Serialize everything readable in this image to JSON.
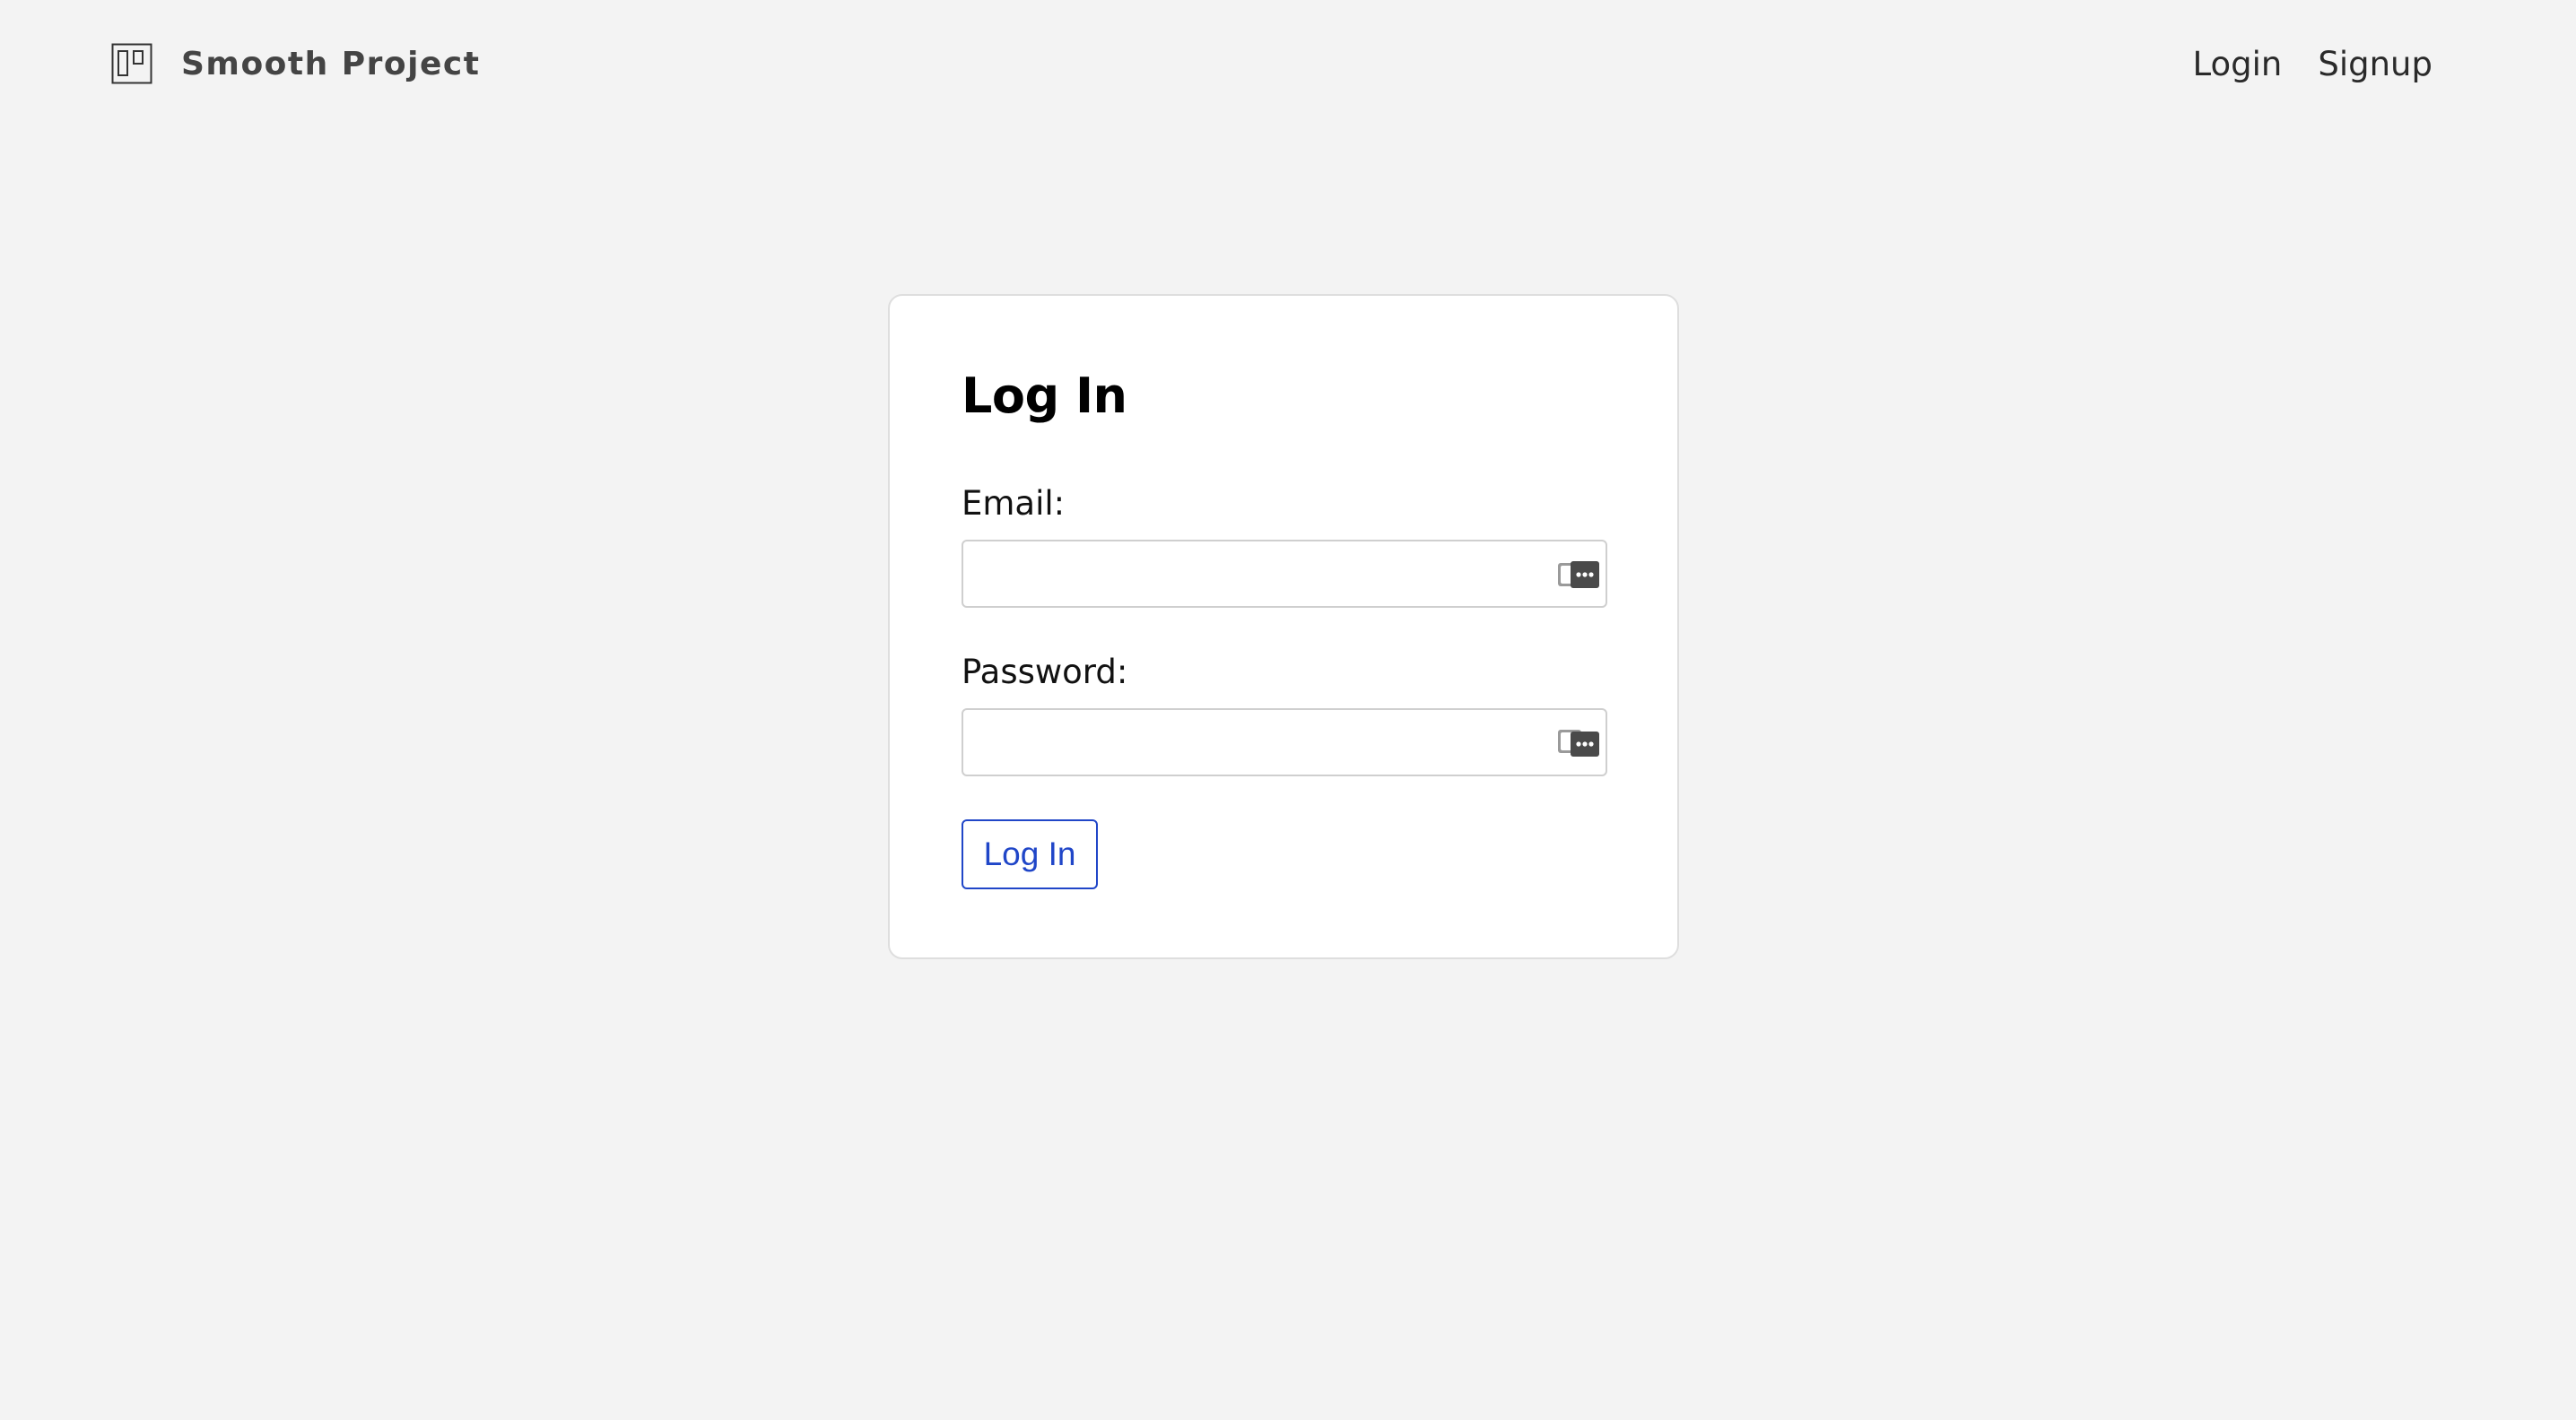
{
  "app": {
    "brand_name": "Smooth Project",
    "logo_icon": "board-icon"
  },
  "nav": {
    "items": [
      {
        "label": "Login"
      },
      {
        "label": "Signup"
      }
    ]
  },
  "login_form": {
    "title": "Log In",
    "email": {
      "label": "Email:",
      "value": "",
      "placeholder": "",
      "icon": "password-manager-autofill-icon"
    },
    "password": {
      "label": "Password:",
      "value": "",
      "placeholder": "",
      "icon": "password-manager-autofill-icon"
    },
    "submit_label": "Log In"
  },
  "colors": {
    "page_background": "#f3f3f3",
    "card_background": "#ffffff",
    "accent": "#2046c8",
    "brand_text": "#444444"
  }
}
